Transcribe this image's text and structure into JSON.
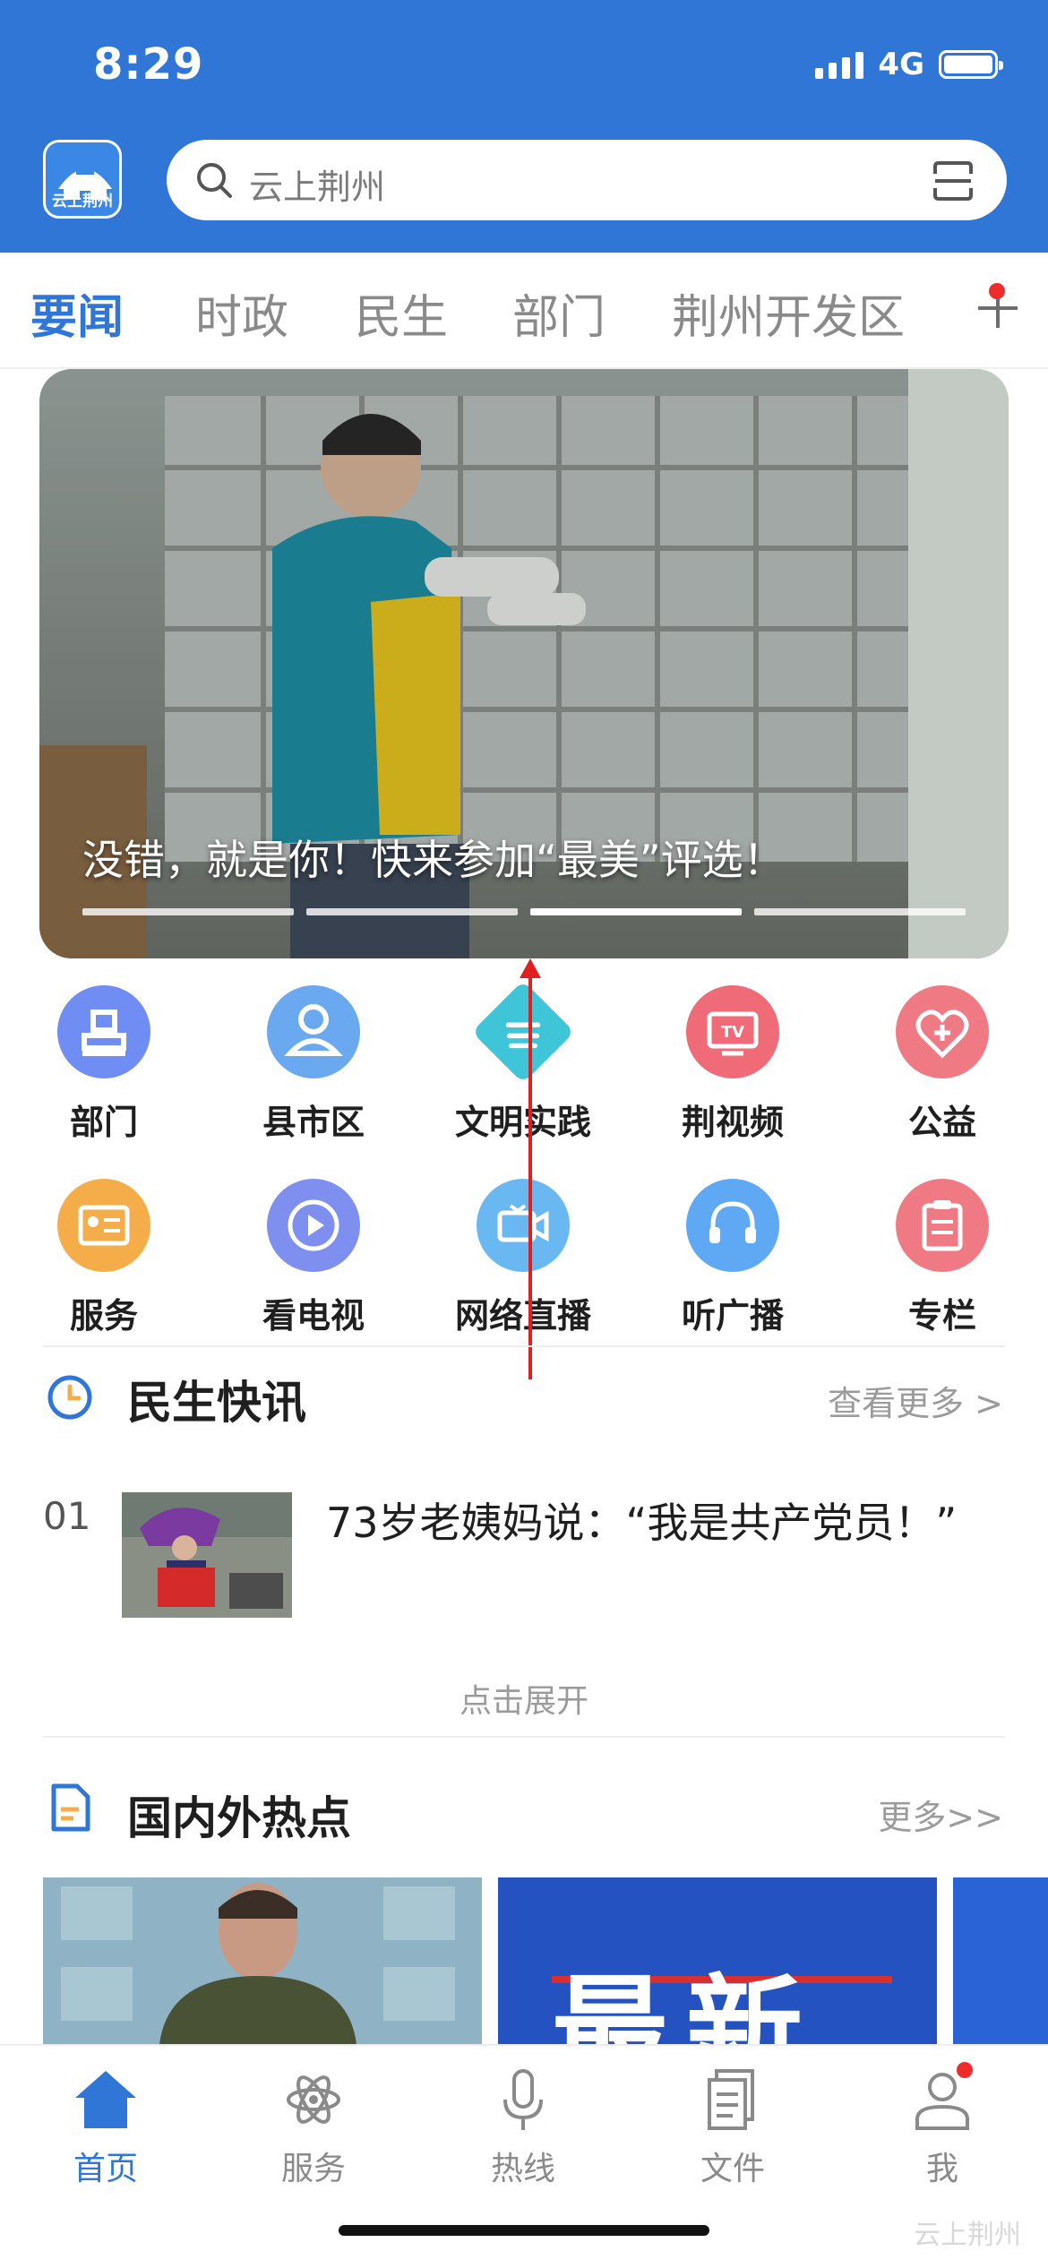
{
  "status_bar": {
    "time": "8:29",
    "network": "4G"
  },
  "header": {
    "logo_text": "云上荆州",
    "search_placeholder": "云上荆州"
  },
  "tabs": [
    {
      "label": "要闻",
      "active": true
    },
    {
      "label": "时政",
      "active": false
    },
    {
      "label": "民生",
      "active": false
    },
    {
      "label": "部门",
      "active": false
    },
    {
      "label": "荆州开发区",
      "active": false
    }
  ],
  "banner": {
    "title": "没错，就是你！快来参加“最美”评选！",
    "active_index": 2,
    "slide_count": 4
  },
  "grid": [
    {
      "label": "部门",
      "icon": "stamp-icon",
      "color": "#6f8df2"
    },
    {
      "label": "县市区",
      "icon": "person-icon",
      "color": "#6aa9f0"
    },
    {
      "label": "文明实践",
      "icon": "hands-icon",
      "color": "#3ec6d8"
    },
    {
      "label": "荆视频",
      "icon": "tv-icon",
      "color": "#f06b78"
    },
    {
      "label": "公益",
      "icon": "heart-icon",
      "color": "#f07a84"
    },
    {
      "label": "服务",
      "icon": "id-card-icon",
      "color": "#f5ad4a"
    },
    {
      "label": "看电视",
      "icon": "play-icon",
      "color": "#7e8ff0"
    },
    {
      "label": "网络直播",
      "icon": "video-camera-icon",
      "color": "#6ab8f2"
    },
    {
      "label": "听广播",
      "icon": "headphones-icon",
      "color": "#5fa8f4"
    },
    {
      "label": "专栏",
      "icon": "clipboard-icon",
      "color": "#f07a84"
    }
  ],
  "livelihood": {
    "title": "民生快讯",
    "more": "查看更多 >",
    "items": [
      {
        "index": "01",
        "title": "73岁老姨妈说：“我是共产党员！”"
      }
    ],
    "expand_label": "点击展开"
  },
  "hot": {
    "title": "国内外热点",
    "more": "更多>>",
    "card2_text": "最新"
  },
  "bottom_nav": [
    {
      "label": "首页",
      "icon": "home-icon",
      "active": true
    },
    {
      "label": "服务",
      "icon": "atom-icon",
      "active": false
    },
    {
      "label": "热线",
      "icon": "microphone-icon",
      "active": false
    },
    {
      "label": "文件",
      "icon": "document-icon",
      "active": false
    },
    {
      "label": "我",
      "icon": "user-icon",
      "active": false
    }
  ],
  "watermark": "云上荆州",
  "colors": {
    "brand": "#2f76d6",
    "badge": "#ef2b2b"
  }
}
